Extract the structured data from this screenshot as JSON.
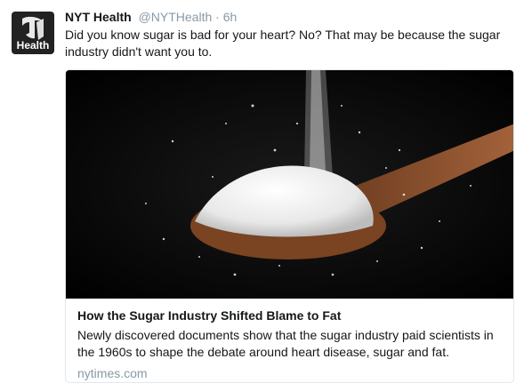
{
  "tweet": {
    "author_name": "NYT Health",
    "handle": "@NYTHealth",
    "separator": "·",
    "time": "6h",
    "text": "Did you know sugar is bad for your heart? No? That may be because the sugar industry didn't want you to."
  },
  "avatar": {
    "label": "Health",
    "icon": "nyt-logo-icon"
  },
  "card": {
    "image": "sugar-spoon-image",
    "title": "How the Sugar Industry Shifted Blame to Fat",
    "description": "Newly discovered documents show that the sugar industry paid scientists in the 1960s to shape the debate around heart disease, sugar and fat.",
    "domain": "nytimes.com"
  }
}
